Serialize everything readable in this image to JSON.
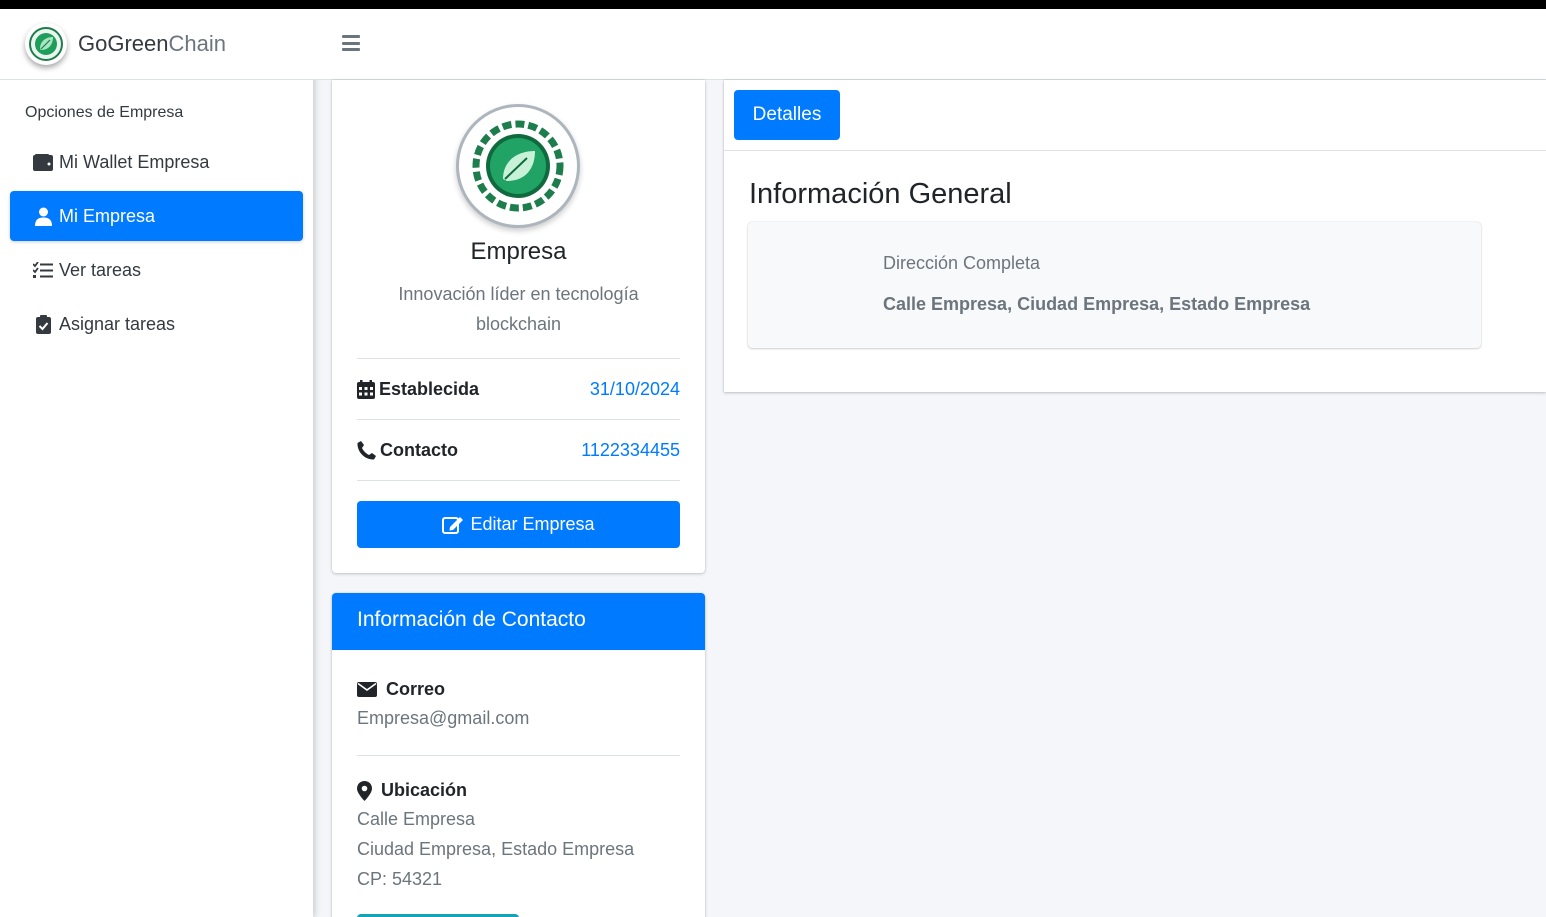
{
  "brand": {
    "name_bold": "GoGreen",
    "name_light": "Chain"
  },
  "sidebar": {
    "header": "Opciones de Empresa",
    "items": [
      {
        "label": "Mi Wallet Empresa",
        "icon": "wallet-icon",
        "active": false
      },
      {
        "label": "Mi Empresa",
        "icon": "user-icon",
        "active": true
      },
      {
        "label": "Ver tareas",
        "icon": "tasks-icon",
        "active": false
      },
      {
        "label": "Asignar tareas",
        "icon": "clipboard-check-icon",
        "active": false
      }
    ]
  },
  "header": {
    "menu_icon": "hamburger-icon"
  },
  "profile": {
    "name": "Empresa",
    "description": "Innovación líder en tecnología blockchain",
    "established_label": "Establecida",
    "established_value": "31/10/2024",
    "contact_label": "Contacto",
    "contact_value": "1122334455",
    "edit_button": "Editar Empresa"
  },
  "contact_info": {
    "title": "Información de Contacto",
    "email_label": "Correo",
    "email_value": "Empresa@gmail.com",
    "location_label": "Ubicación",
    "location_line1": "Calle Empresa",
    "location_line2": "Ciudad Empresa, Estado Empresa",
    "location_line3": "CP: 54321"
  },
  "details": {
    "tab_label": "Detalles",
    "section_title": "Información General",
    "address_label": "Dirección Completa",
    "address_value": "Calle Empresa, Ciudad Empresa, Estado Empresa"
  },
  "colors": {
    "primary": "#007bff",
    "teal": "#17a2b8",
    "background": "#f4f6f9"
  }
}
